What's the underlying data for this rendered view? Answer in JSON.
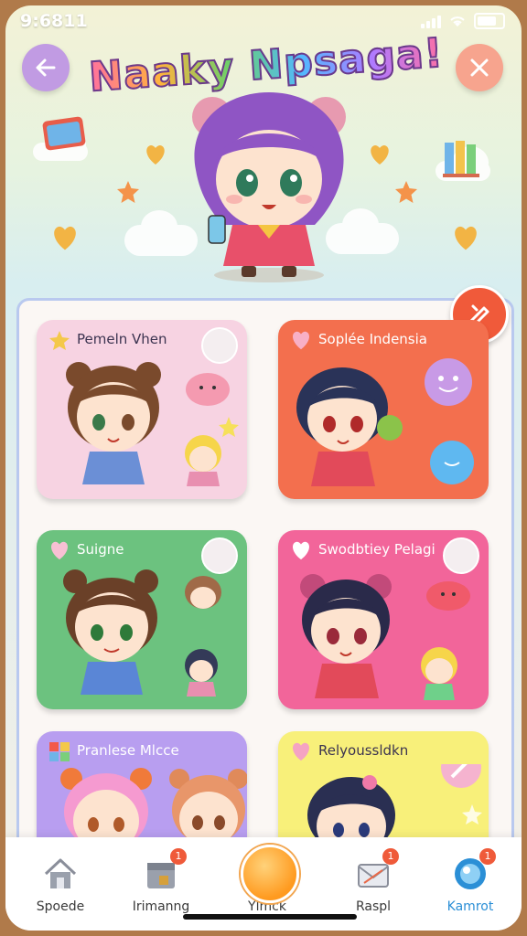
{
  "status_bar": {
    "time": "9:6811"
  },
  "header": {
    "title": "Naaky Npsaga!",
    "back_icon": "arrow-left-icon",
    "close_icon": "close-icon"
  },
  "cards": [
    {
      "label": "Pemeln Vhen",
      "bg": "#f7d3e2",
      "label_color": "#3b3350"
    },
    {
      "label": "Soplée Indensia",
      "bg": "#f36f4e",
      "label_color": "#ffffff"
    },
    {
      "label": "Suigne",
      "bg": "#6cc27f",
      "label_color": "#ffffff"
    },
    {
      "label": "Swodbtiey Pelagi",
      "bg": "#f2659a",
      "label_color": "#ffffff"
    },
    {
      "label": "Pranlese Mlcce",
      "bg": "#b89ef0",
      "label_color": "#ffffff"
    },
    {
      "label": "Relyoussldkn",
      "bg": "#f8f07a",
      "label_color": "#3b3350"
    }
  ],
  "nav": {
    "items": [
      {
        "label": "Spoede",
        "icon": "home-icon",
        "badge": ""
      },
      {
        "label": "Irimanng",
        "icon": "box-icon",
        "badge": "1"
      },
      {
        "label": "Ylmck",
        "icon": "orb-icon",
        "badge": ""
      },
      {
        "label": "Raspl",
        "icon": "mail-icon",
        "badge": "1"
      },
      {
        "label": "Kamrot",
        "icon": "globe-icon",
        "badge": "1"
      }
    ],
    "active_color": "#2b8fd6"
  }
}
